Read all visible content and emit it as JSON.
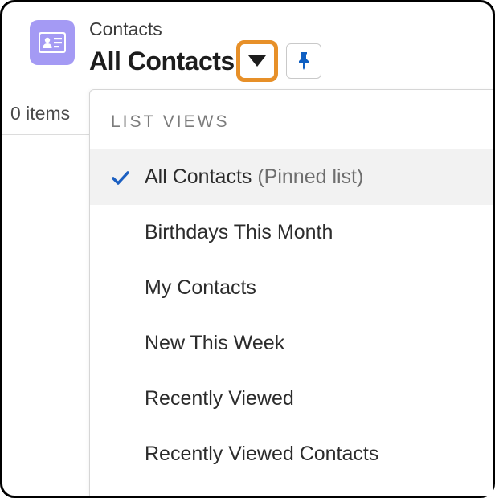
{
  "header": {
    "object_label": "Contacts",
    "view_title": "All Contacts"
  },
  "count_text": "0 items",
  "dropdown": {
    "heading": "LIST VIEWS",
    "items": [
      {
        "label": "All Contacts",
        "suffix": "(Pinned list)",
        "selected": true
      },
      {
        "label": "Birthdays This Month",
        "suffix": "",
        "selected": false
      },
      {
        "label": "My Contacts",
        "suffix": "",
        "selected": false
      },
      {
        "label": "New This Week",
        "suffix": "",
        "selected": false
      },
      {
        "label": "Recently Viewed",
        "suffix": "",
        "selected": false
      },
      {
        "label": "Recently Viewed Contacts",
        "suffix": "",
        "selected": false
      }
    ]
  },
  "colors": {
    "object_icon_bg": "#a49af4",
    "highlight_border": "#e79029",
    "pin_color": "#0f5fc2",
    "check_color": "#1b5fc1"
  }
}
